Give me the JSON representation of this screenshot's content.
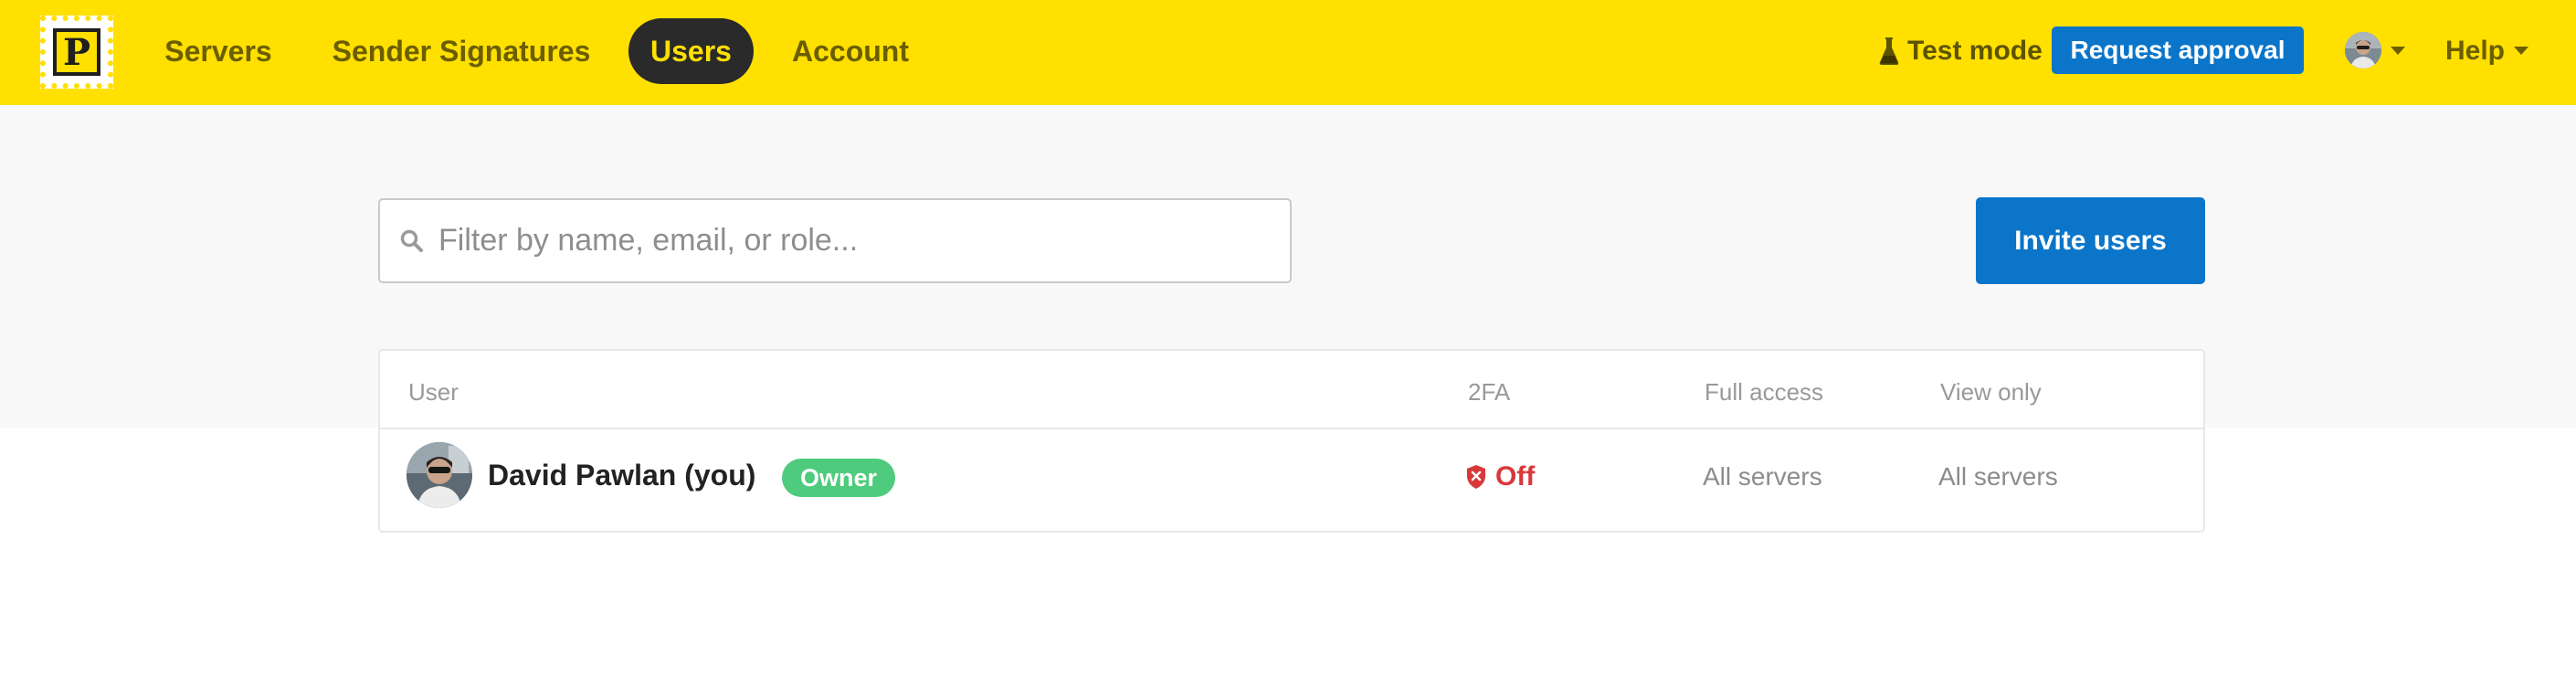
{
  "nav": {
    "logo_letter": "P",
    "items": [
      {
        "label": "Servers",
        "active": false
      },
      {
        "label": "Sender Signatures",
        "active": false
      },
      {
        "label": "Users",
        "active": true
      },
      {
        "label": "Account",
        "active": false
      }
    ],
    "test_mode_label": "Test mode",
    "test_mode_icon": "flask-icon",
    "request_approval_label": "Request approval",
    "help_label": "Help"
  },
  "search": {
    "placeholder": "Filter by name, email, or role...",
    "value": "",
    "icon": "search-icon"
  },
  "invite_label": "Invite users",
  "table": {
    "columns": [
      "User",
      "2FA",
      "Full access",
      "View only"
    ],
    "rows": [
      {
        "name": "David Pawlan (you)",
        "role": "Owner",
        "twofa": "Off",
        "twofa_icon": "shield-x-icon",
        "full_access": "All servers",
        "view_only": "All servers"
      }
    ]
  },
  "colors": {
    "brand_yellow": "#ffe000",
    "primary_blue": "#0a75c9",
    "owner_green": "#4ecb7c",
    "danger_red": "#d9383a"
  }
}
